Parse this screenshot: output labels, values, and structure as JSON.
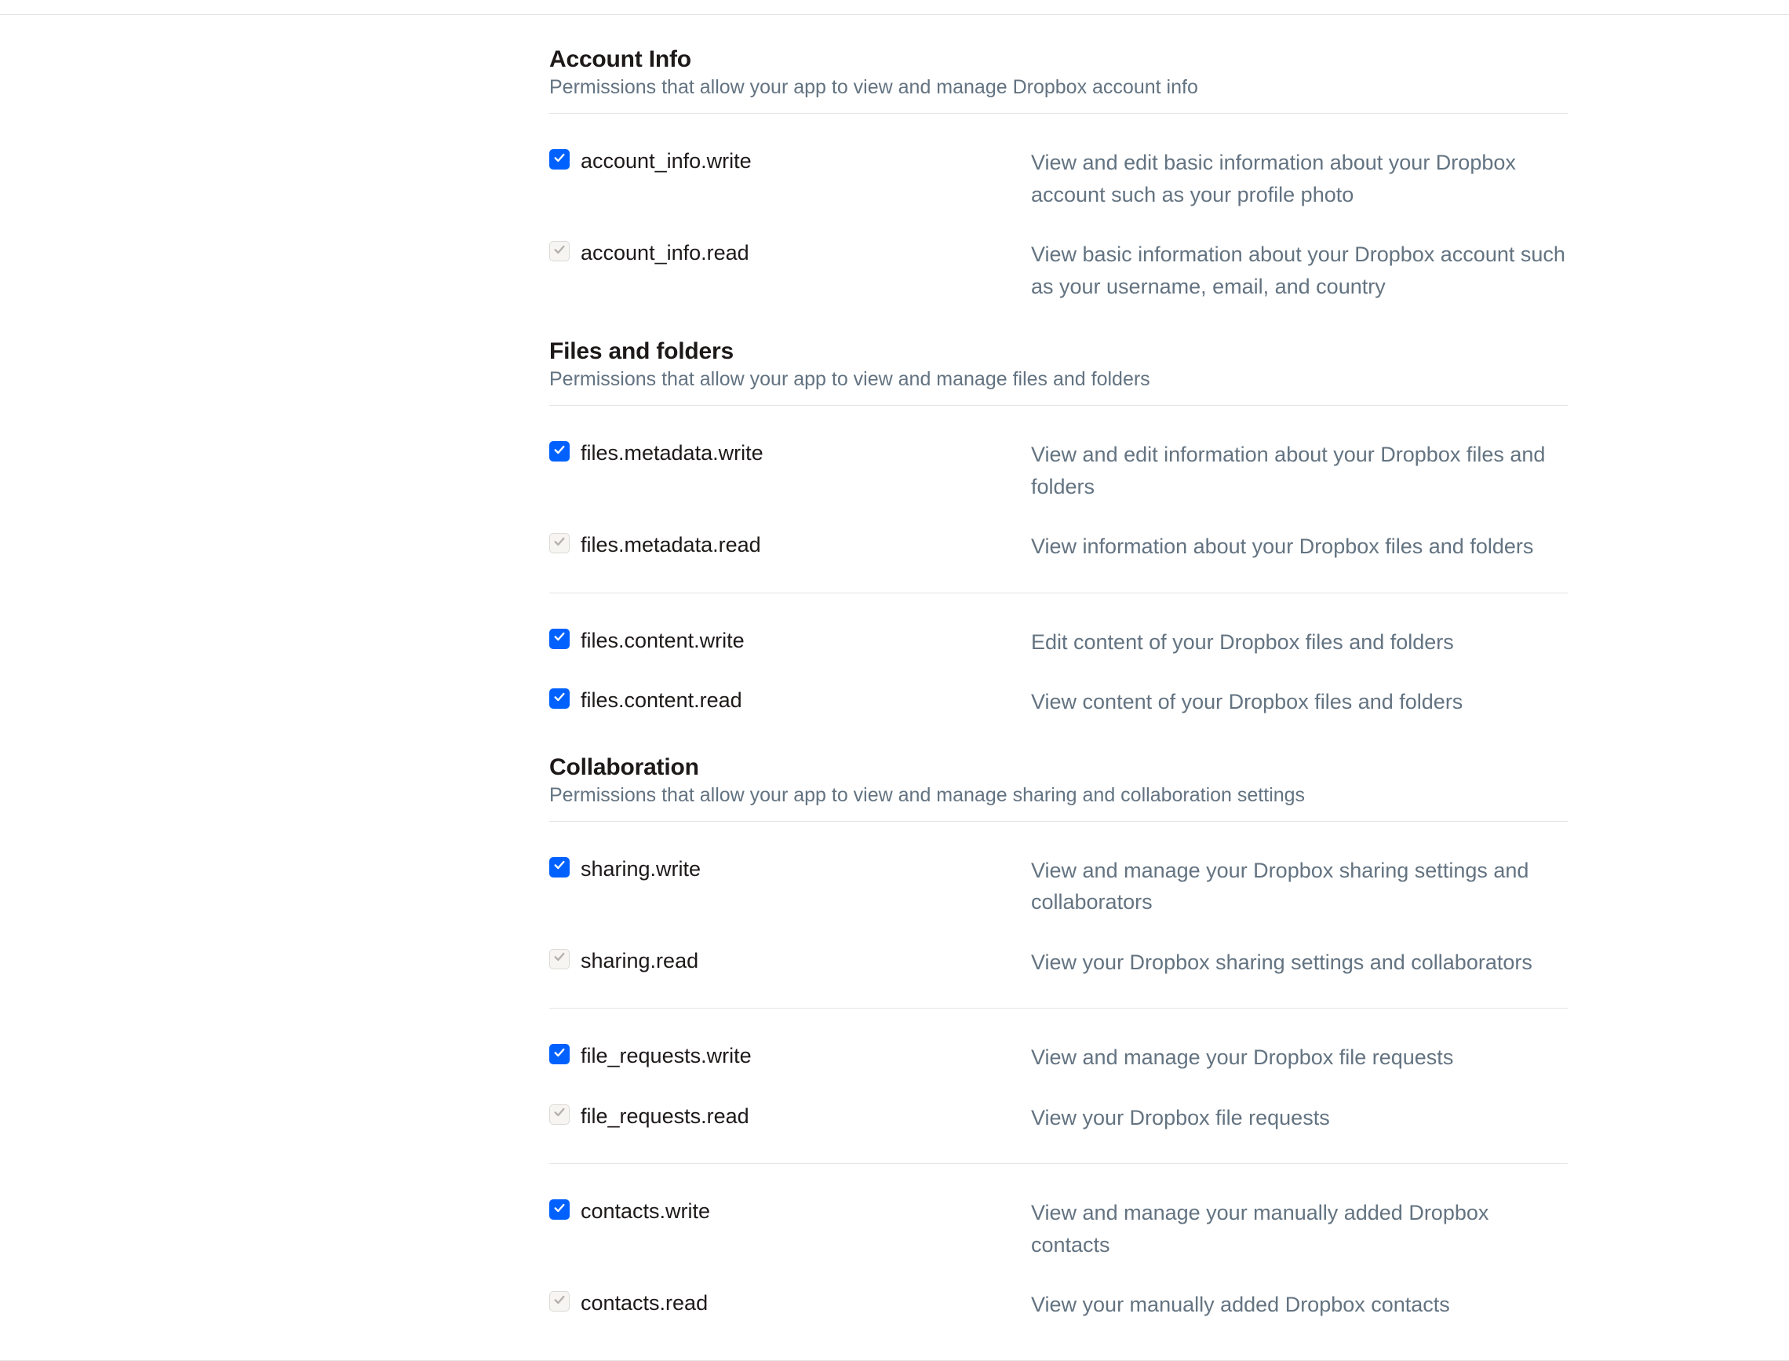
{
  "sections": [
    {
      "title": "Account Info",
      "subtitle": "Permissions that allow your app to view and manage Dropbox account info",
      "groups": [
        [
          {
            "name": "account_info.write",
            "desc": "View and edit basic information about your Dropbox account such as your profile photo",
            "checked": true,
            "enabled": true
          },
          {
            "name": "account_info.read",
            "desc": "View basic information about your Dropbox account such as your username, email, and country",
            "checked": true,
            "enabled": false
          }
        ]
      ]
    },
    {
      "title": "Files and folders",
      "subtitle": "Permissions that allow your app to view and manage files and folders",
      "groups": [
        [
          {
            "name": "files.metadata.write",
            "desc": "View and edit information about your Dropbox files and folders",
            "checked": true,
            "enabled": true
          },
          {
            "name": "files.metadata.read",
            "desc": "View information about your Dropbox files and folders",
            "checked": true,
            "enabled": false
          }
        ],
        [
          {
            "name": "files.content.write",
            "desc": "Edit content of your Dropbox files and folders",
            "checked": true,
            "enabled": true
          },
          {
            "name": "files.content.read",
            "desc": "View content of your Dropbox files and folders",
            "checked": true,
            "enabled": true
          }
        ]
      ]
    },
    {
      "title": "Collaboration",
      "subtitle": "Permissions that allow your app to view and manage sharing and collaboration settings",
      "groups": [
        [
          {
            "name": "sharing.write",
            "desc": "View and manage your Dropbox sharing settings and collaborators",
            "checked": true,
            "enabled": true
          },
          {
            "name": "sharing.read",
            "desc": "View your Dropbox sharing settings and collaborators",
            "checked": true,
            "enabled": false
          }
        ],
        [
          {
            "name": "file_requests.write",
            "desc": "View and manage your Dropbox file requests",
            "checked": true,
            "enabled": true
          },
          {
            "name": "file_requests.read",
            "desc": "View your Dropbox file requests",
            "checked": true,
            "enabled": false
          }
        ],
        [
          {
            "name": "contacts.write",
            "desc": "View and manage your manually added Dropbox contacts",
            "checked": true,
            "enabled": true
          },
          {
            "name": "contacts.read",
            "desc": "View your manually added Dropbox contacts",
            "checked": true,
            "enabled": false
          }
        ]
      ]
    }
  ]
}
